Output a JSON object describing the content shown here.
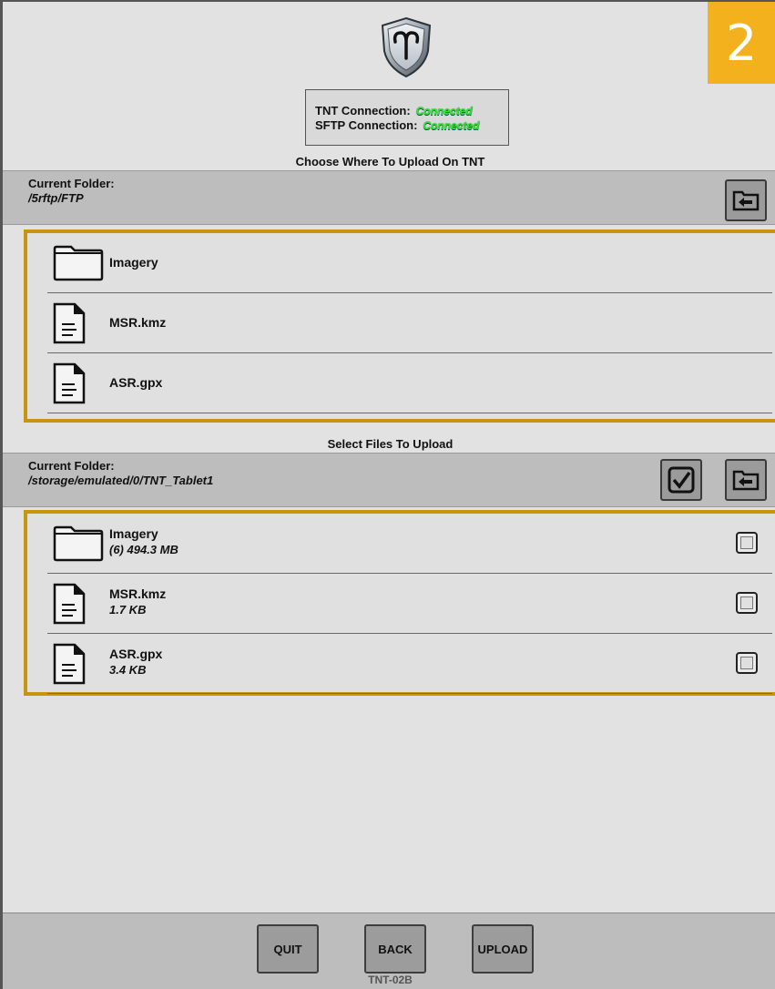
{
  "step_badge": "2",
  "connection": {
    "tnt_label": "TNT Connection:",
    "tnt_status": "Connected",
    "sftp_label": "SFTP Connection:",
    "sftp_status": "Connected"
  },
  "remote": {
    "section_title": "Choose Where To Upload On TNT",
    "folder_label": "Current Folder:",
    "folder_path": "/5rftp/FTP",
    "items": [
      {
        "name": "Imagery",
        "type": "folder"
      },
      {
        "name": "MSR.kmz",
        "type": "file"
      },
      {
        "name": "ASR.gpx",
        "type": "file"
      }
    ]
  },
  "local": {
    "section_title": "Select Files To Upload",
    "folder_label": "Current Folder:",
    "folder_path": "/storage/emulated/0/TNT_Tablet1",
    "items": [
      {
        "name": "Imagery",
        "detail": "(6) 494.3 MB",
        "type": "folder",
        "checked": false
      },
      {
        "name": "MSR.kmz",
        "detail": "1.7 KB",
        "type": "file",
        "checked": false
      },
      {
        "name": "ASR.gpx",
        "detail": "3.4 KB",
        "type": "file",
        "checked": false
      }
    ]
  },
  "buttons": {
    "quit": "QUIT",
    "back": "BACK",
    "upload": "UPLOAD"
  },
  "device_id": "TNT-02B",
  "colors": {
    "accent_badge": "#f3b21d",
    "panel_border": "#c7960e",
    "connected": "#2ee52e"
  }
}
